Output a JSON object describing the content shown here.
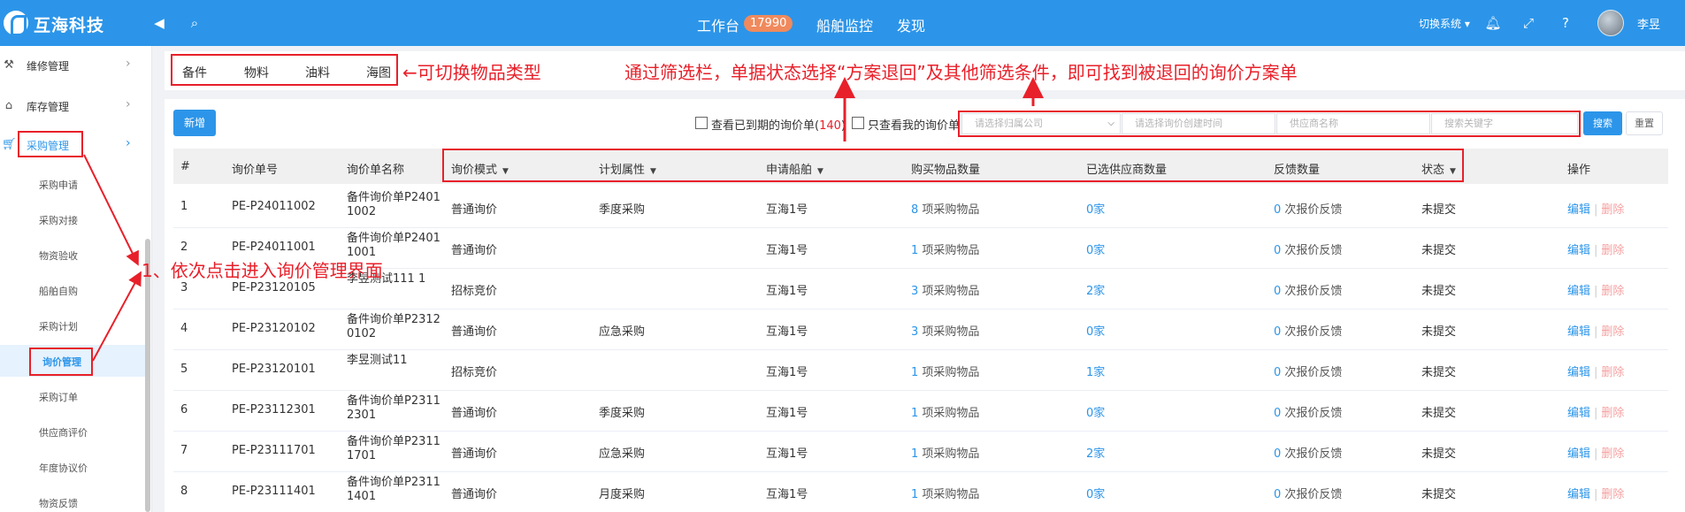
{
  "header": {
    "brand": "互海科技",
    "nav": [
      "工作台",
      "船舶监控",
      "发现"
    ],
    "workbench_count": "17990",
    "switch_system": "切换系统",
    "user_name": "李昱"
  },
  "sidebar": {
    "top_items": [
      {
        "label": "维修管理",
        "icon": "wrench-icon"
      },
      {
        "label": "库存管理",
        "icon": "home-icon"
      },
      {
        "label": "采购管理",
        "icon": "cart-icon"
      }
    ],
    "sub_items": [
      "采购申请",
      "采购对接",
      "物资验收",
      "船舶自购",
      "采购计划",
      "询价管理",
      "采购订单",
      "供应商评价",
      "年度协议价",
      "物资反馈"
    ]
  },
  "tabs": [
    "备件",
    "物料",
    "油料",
    "海图"
  ],
  "toolbar": {
    "add_label": "新增",
    "expired_label": "查看已到期的询价单(",
    "expired_count": "140",
    "expired_close": ")",
    "mine_label": "只查看我的询价单",
    "company_placeholder": "请选择归属公司",
    "date_placeholder": "请选择询价创建时间",
    "supplier_placeholder": "供应商名称",
    "keyword_placeholder": "搜索关键字",
    "search_label": "搜索",
    "reset_label": "重置"
  },
  "table": {
    "headers": [
      "#",
      "询价单号",
      "询价单名称",
      "询价模式",
      "计划属性",
      "申请船舶",
      "购买物品数量",
      "已选供应商数量",
      "反馈数量",
      "状态",
      "操作"
    ],
    "rows": [
      {
        "no": "1",
        "code": "PE-P24011002",
        "name": "备件询价单P2401 1002",
        "mode": "普通询价",
        "plan": "季度采购",
        "ship": "互海1号",
        "qty": "8",
        "qty_unit": " 项采购物品",
        "suppliers": "0",
        "supplier_unit": "家",
        "feedback": "0",
        "feedback_unit": " 次报价反馈",
        "status": "未提交",
        "edit": "编辑",
        "delete": "删除"
      },
      {
        "no": "2",
        "code": "PE-P24011001",
        "name": "备件询价单P2401 1001",
        "mode": "普通询价",
        "plan": "",
        "ship": "互海1号",
        "qty": "1",
        "qty_unit": " 项采购物品",
        "suppliers": "0",
        "supplier_unit": "家",
        "feedback": "0",
        "feedback_unit": " 次报价反馈",
        "status": "未提交",
        "edit": "编辑",
        "delete": "删除"
      },
      {
        "no": "3",
        "code": "PE-P23120105",
        "name": "李昱测试111 1",
        "mode": "招标竞价",
        "plan": "",
        "ship": "互海1号",
        "qty": "3",
        "qty_unit": " 项采购物品",
        "suppliers": "2",
        "supplier_unit": "家",
        "feedback": "0",
        "feedback_unit": " 次报价反馈",
        "status": "未提交",
        "edit": "编辑",
        "delete": "删除"
      },
      {
        "no": "4",
        "code": "PE-P23120102",
        "name": "备件询价单P2312 0102",
        "mode": "普通询价",
        "plan": "应急采购",
        "ship": "互海1号",
        "qty": "3",
        "qty_unit": " 项采购物品",
        "suppliers": "0",
        "supplier_unit": "家",
        "feedback": "0",
        "feedback_unit": " 次报价反馈",
        "status": "未提交",
        "edit": "编辑",
        "delete": "删除"
      },
      {
        "no": "5",
        "code": "PE-P23120101",
        "name": "李昱测试11",
        "mode": "招标竞价",
        "plan": "",
        "ship": "互海1号",
        "qty": "1",
        "qty_unit": " 项采购物品",
        "suppliers": "1",
        "supplier_unit": "家",
        "feedback": "0",
        "feedback_unit": " 次报价反馈",
        "status": "未提交",
        "edit": "编辑",
        "delete": "删除"
      },
      {
        "no": "6",
        "code": "PE-P23112301",
        "name": "备件询价单P2311 2301",
        "mode": "普通询价",
        "plan": "季度采购",
        "ship": "互海1号",
        "qty": "1",
        "qty_unit": " 项采购物品",
        "suppliers": "0",
        "supplier_unit": "家",
        "feedback": "0",
        "feedback_unit": " 次报价反馈",
        "status": "未提交",
        "edit": "编辑",
        "delete": "删除"
      },
      {
        "no": "7",
        "code": "PE-P23111701",
        "name": "备件询价单P2311 1701",
        "mode": "普通询价",
        "plan": "应急采购",
        "ship": "互海1号",
        "qty": "1",
        "qty_unit": " 项采购物品",
        "suppliers": "2",
        "supplier_unit": "家",
        "feedback": "0",
        "feedback_unit": " 次报价反馈",
        "status": "未提交",
        "edit": "编辑",
        "delete": "删除"
      },
      {
        "no": "8",
        "code": "PE-P23111401",
        "name": "备件询价单P2311 1401",
        "mode": "普通询价",
        "plan": "月度采购",
        "ship": "互海1号",
        "qty": "1",
        "qty_unit": " 项采购物品",
        "suppliers": "0",
        "supplier_unit": "家",
        "feedback": "0",
        "feedback_unit": " 次报价反馈",
        "status": "未提交",
        "edit": "编辑",
        "delete": "删除"
      }
    ]
  },
  "annotations": {
    "tabs_note": "可切换物品类型",
    "filter_note": "通过筛选栏，单据状态选择“方案退回”及其他筛选条件，即可找到被退回的询价方案单",
    "nav_note": "1、依次点击进入询价管理界面"
  },
  "colors": {
    "primary": "#2c95e9",
    "annotation": "#e8202a",
    "badge": "#f08a5d"
  }
}
